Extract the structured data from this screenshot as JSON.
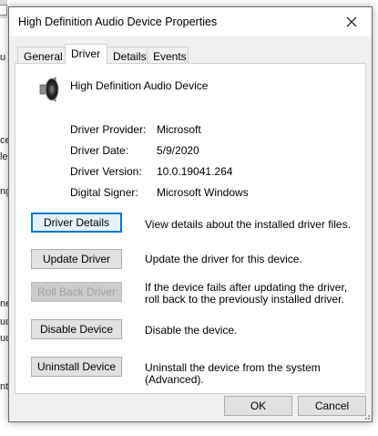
{
  "background": {
    "fragments": [
      "u",
      "ce",
      "le",
      "ng",
      "ne",
      "ud",
      "ud",
      "nt"
    ]
  },
  "window": {
    "title": "High Definition Audio Device Properties",
    "close_icon": "close-icon"
  },
  "tabs": [
    {
      "label": "General",
      "active": false
    },
    {
      "label": "Driver",
      "active": true
    },
    {
      "label": "Details",
      "active": false
    },
    {
      "label": "Events",
      "active": false
    }
  ],
  "device": {
    "icon": "speaker-icon",
    "name": "High Definition Audio Device"
  },
  "driver_info": [
    {
      "label": "Driver Provider:",
      "value": "Microsoft"
    },
    {
      "label": "Driver Date:",
      "value": "5/9/2020"
    },
    {
      "label": "Driver Version:",
      "value": "10.0.19041.264"
    },
    {
      "label": "Digital Signer:",
      "value": "Microsoft Windows"
    }
  ],
  "actions": [
    {
      "label": "Driver Details",
      "description": "View details about the installed driver files.",
      "enabled": true,
      "focused": true
    },
    {
      "label": "Update Driver",
      "description": "Update the driver for this device.",
      "enabled": true,
      "focused": false
    },
    {
      "label": "Roll Back Driver",
      "description": "If the device fails after updating the driver, roll back to the previously installed driver.",
      "enabled": false,
      "focused": false
    },
    {
      "label": "Disable Device",
      "description": "Disable the device.",
      "enabled": true,
      "focused": false
    },
    {
      "label": "Uninstall Device",
      "description": "Uninstall the device from the system (Advanced).",
      "enabled": true,
      "focused": false
    }
  ],
  "footer": {
    "ok_label": "OK",
    "cancel_label": "Cancel"
  },
  "colors": {
    "focus_border": "#0078d7",
    "dialog_bg": "#f0f0f0",
    "button_bg": "#e1e1e1"
  }
}
